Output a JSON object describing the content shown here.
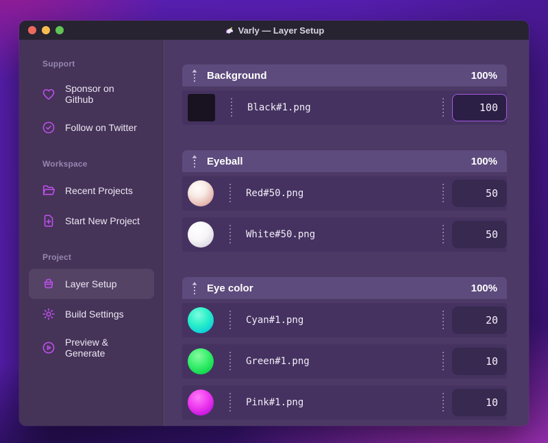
{
  "window": {
    "title": "Varly — Layer Setup",
    "title_icon": "unicorn-icon"
  },
  "colors": {
    "accent_icon": "#bb4fe8",
    "focus_border": "#a55ae6",
    "traffic_red": "#ed6a5f",
    "traffic_yellow": "#f5bd4f",
    "traffic_green": "#61c455"
  },
  "sidebar": {
    "sections": [
      {
        "label": "Support",
        "items": [
          {
            "icon": "heart-icon",
            "label": "Sponsor on Github"
          },
          {
            "icon": "verified-badge-icon",
            "label": "Follow on Twitter"
          }
        ]
      },
      {
        "label": "Workspace",
        "items": [
          {
            "icon": "folder-icon",
            "label": "Recent Projects"
          },
          {
            "icon": "file-plus-icon",
            "label": "Start New Project"
          }
        ]
      },
      {
        "label": "Project",
        "items": [
          {
            "icon": "layer-box-icon",
            "label": "Layer Setup",
            "active": true
          },
          {
            "icon": "gear-icon",
            "label": "Build Settings"
          },
          {
            "icon": "play-circle-icon",
            "label": "Preview & Generate"
          }
        ]
      }
    ]
  },
  "main": {
    "groups": [
      {
        "title": "Background",
        "percent": "100%",
        "rows": [
          {
            "thumb": "black-square",
            "filename": "Black#1.png",
            "value": "100",
            "focused": true
          }
        ]
      },
      {
        "title": "Eyeball",
        "percent": "100%",
        "rows": [
          {
            "thumb": "red-sphere",
            "filename": "Red#50.png",
            "value": "50"
          },
          {
            "thumb": "white-sphere",
            "filename": "White#50.png",
            "value": "50"
          }
        ]
      },
      {
        "title": "Eye color",
        "percent": "100%",
        "rows": [
          {
            "thumb": "cyan-sphere",
            "filename": "Cyan#1.png",
            "value": "20"
          },
          {
            "thumb": "green-sphere",
            "filename": "Green#1.png",
            "value": "10"
          },
          {
            "thumb": "pink-sphere",
            "filename": "Pink#1.png",
            "value": "10"
          }
        ]
      }
    ]
  }
}
